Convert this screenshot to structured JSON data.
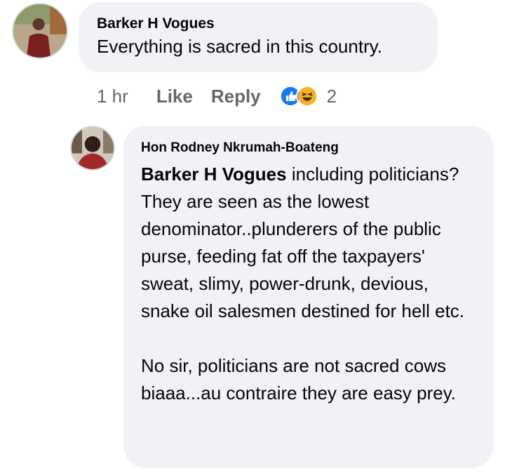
{
  "comments": [
    {
      "author": "Barker H Vogues",
      "text": "Everything is sacred in this country.",
      "time": "1 hr",
      "like_label": "Like",
      "reply_label": "Reply",
      "reactions": [
        "like-icon",
        "haha-icon"
      ],
      "reaction_count": "2"
    },
    {
      "author": "Hon Rodney Nkrumah-Boateng",
      "mention": "Barker H Vogues",
      "paragraph1": "including politicians? They are seen as the lowest denominator..plunderers of the public purse, feeding fat off the taxpayers' sweat, slimy, power-drunk, devious, snake oil salesmen destined for hell etc.",
      "paragraph2": "No sir, politicians are not sacred cows biaaa...au contraire they are easy prey."
    }
  ],
  "colors": {
    "bubble": "#f0f2f5",
    "meta_text": "#65676b",
    "like_blue": "#1877f2",
    "haha_yellow": "#f7b125"
  }
}
